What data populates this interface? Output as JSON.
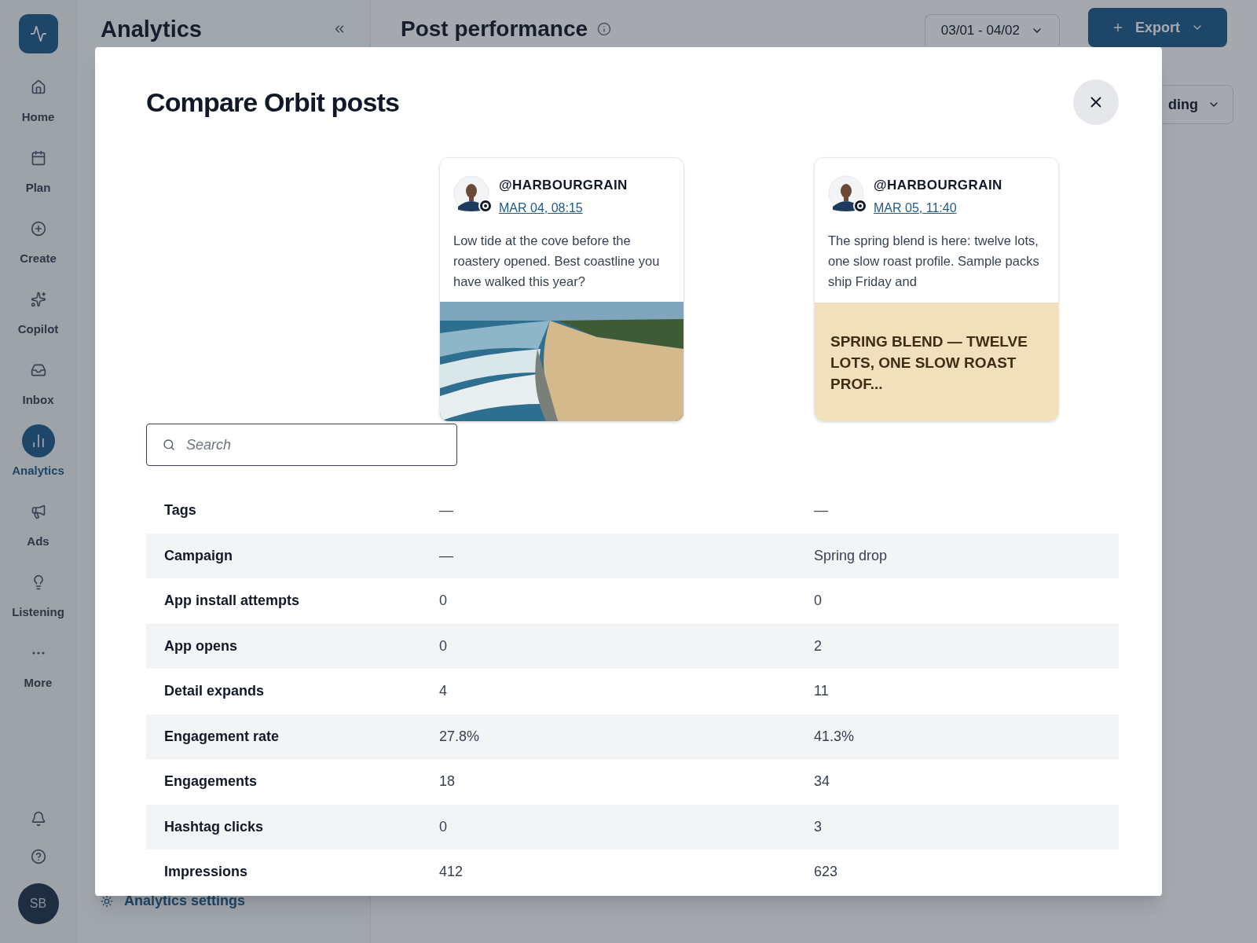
{
  "sidebar": {
    "items": [
      {
        "label": "Home",
        "selected": false
      },
      {
        "label": "Plan",
        "selected": false
      },
      {
        "label": "Create",
        "selected": false
      },
      {
        "label": "Copilot",
        "selected": false
      },
      {
        "label": "Inbox",
        "selected": false
      },
      {
        "label": "Analytics",
        "selected": true
      },
      {
        "label": "Ads",
        "selected": false
      },
      {
        "label": "Listening",
        "selected": false
      },
      {
        "label": "More",
        "selected": false
      }
    ],
    "avatar": "SB"
  },
  "panel": {
    "title": "Analytics",
    "settings_link": "Analytics settings"
  },
  "header": {
    "title": "Post performance",
    "date_range": "03/01 - 04/02",
    "export_button": "Export",
    "sort_button": "ding"
  },
  "modal": {
    "title": "Compare Orbit posts",
    "posts": [
      {
        "handle": "@HARBOURGRAIN",
        "date": "MAR 04, 08:15",
        "text": "Low tide at the cove before the roastery opened. Best coastline you have walked this year?"
      },
      {
        "handle": "@HARBOURGRAIN",
        "date": "MAR 05, 11:40",
        "text": "The spring blend is here: twelve lots, one slow roast profile. Sample packs ship Friday and",
        "media": {
          "kind": "text",
          "text": "SPRING BLEND — TWELVE LOTS, ONE SLOW ROAST PROF..."
        }
      }
    ],
    "search": {
      "placeholder": "Search"
    },
    "metrics": [
      {
        "label": "Tags",
        "values": [
          "—",
          "—"
        ]
      },
      {
        "label": "Campaign",
        "values": [
          "—",
          "Spring drop"
        ]
      },
      {
        "label": "App install attempts",
        "values": [
          "0",
          "0"
        ]
      },
      {
        "label": "App opens",
        "values": [
          "0",
          "2"
        ]
      },
      {
        "label": "Detail expands",
        "values": [
          "4",
          "11"
        ]
      },
      {
        "label": "Engagement rate",
        "values": [
          "27.8%",
          "41.3%"
        ]
      },
      {
        "label": "Engagements",
        "values": [
          "18",
          "34"
        ]
      },
      {
        "label": "Hashtag clicks",
        "values": [
          "0",
          "3"
        ]
      },
      {
        "label": "Impressions",
        "values": [
          "412",
          "623"
        ]
      }
    ]
  }
}
